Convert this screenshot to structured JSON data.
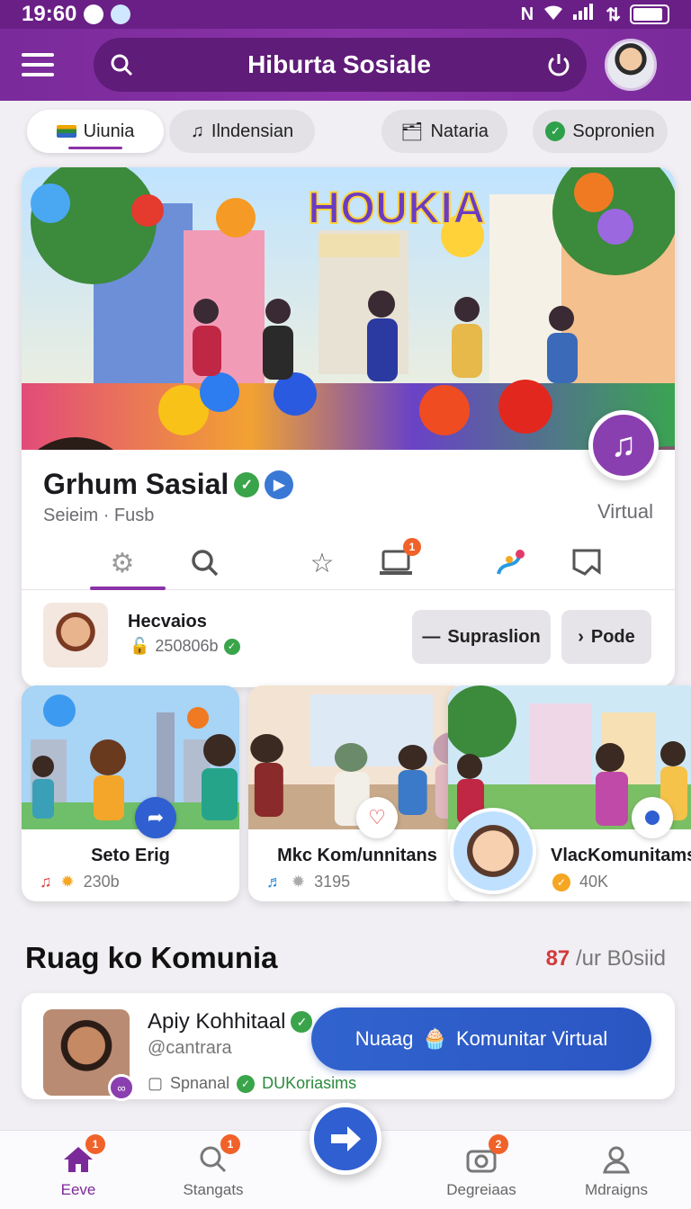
{
  "status": {
    "time": "19:60"
  },
  "header": {
    "title": "Hiburta Sosiale"
  },
  "chips": [
    {
      "label": "Uiunia"
    },
    {
      "label": "Ilndensian"
    },
    {
      "label": "Nataria"
    },
    {
      "label": "Sopronien"
    }
  ],
  "hero": {
    "banner_text": "HOUKIA"
  },
  "group": {
    "name": "Grhum Sasial",
    "sub": "Seieim · Fusb",
    "tag": "Virtual"
  },
  "member": {
    "name": "Hecvaios",
    "id": "250806b",
    "secondary_button": "Supraslion",
    "primary_button": "Pode"
  },
  "cards": [
    {
      "title": "Seto Erig",
      "count": "230b"
    },
    {
      "title": "Mkc Kom/unnitans",
      "count": "3195"
    },
    {
      "title": "VlacKomunitams",
      "count": "40K"
    }
  ],
  "section": {
    "title": "Ruag ko Komunia",
    "count": "87",
    "count_label": "/ur B0siid"
  },
  "post": {
    "name": "Apiy Kohhitaal",
    "handle": "@cantrara",
    "foot_label": "Spnanal",
    "foot_status": "DUKoriasims",
    "cta": "Nuaag",
    "cta2": "Komunitar Virtual"
  },
  "nav": [
    {
      "label": "Eeve",
      "badge": "1"
    },
    {
      "label": "Stangats",
      "badge": "1"
    },
    {
      "label": "Degreiaas",
      "badge": "2"
    },
    {
      "label": "Mdraigns"
    }
  ],
  "colors": {
    "primary": "#7a2a9a",
    "accent_blue": "#2f5fd0",
    "badge": "#f0622a",
    "verified": "#3aa44a"
  }
}
